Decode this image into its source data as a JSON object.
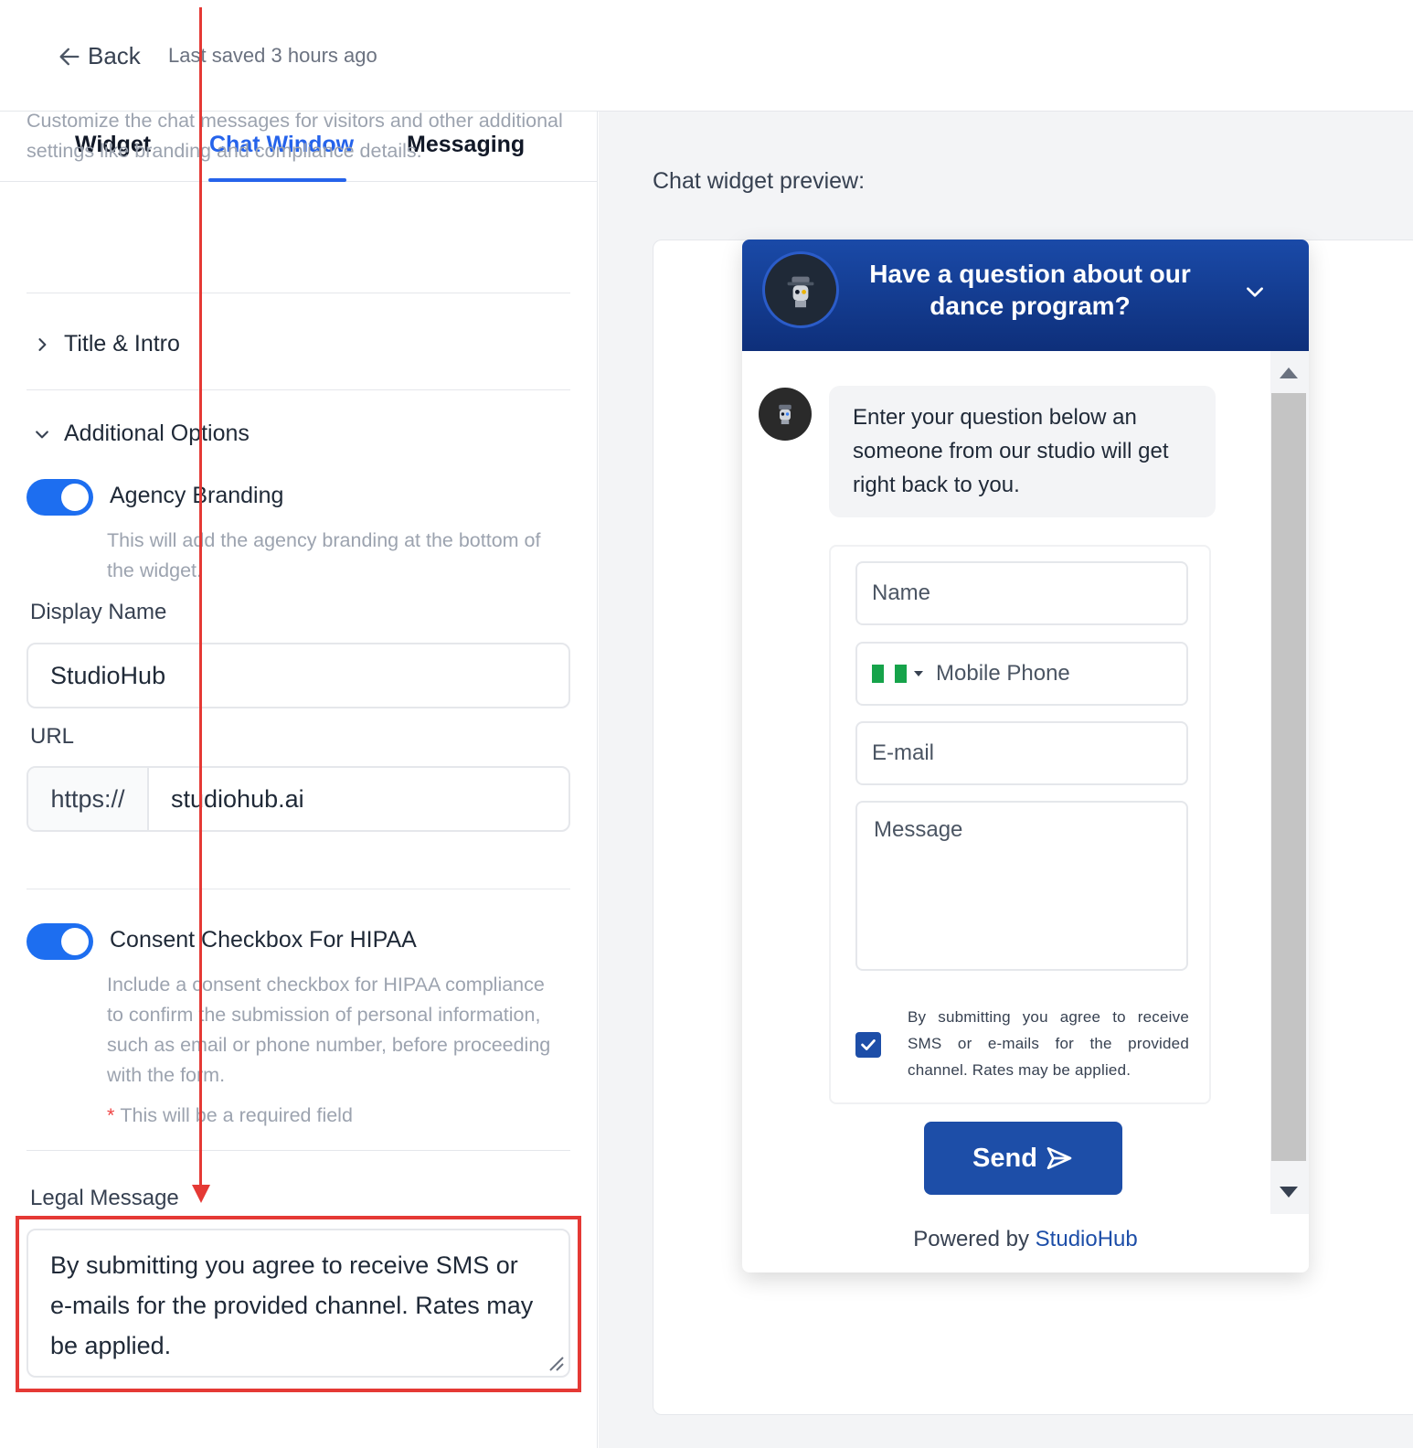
{
  "topbar": {
    "back_label": "Back",
    "saved_text": "Last saved 3 hours ago"
  },
  "tabs": [
    {
      "label": "Widget",
      "active": false
    },
    {
      "label": "Chat Window",
      "active": true
    },
    {
      "label": "Messaging",
      "active": false
    }
  ],
  "settings": {
    "description": "Customize the chat messages for visitors and other additional settings like branding and compliance details.",
    "sections": {
      "title_intro": "Title & Intro",
      "additional_options": "Additional Options"
    },
    "agency_branding": {
      "title": "Agency Branding",
      "enabled": true,
      "help": "This will add the agency branding at the bottom of the widget."
    },
    "display_name": {
      "label": "Display Name",
      "value": "StudioHub"
    },
    "url": {
      "label": "URL",
      "prefix": "https://",
      "value": "studiohub.ai"
    },
    "hipaa": {
      "title": "Consent Checkbox For HIPAA",
      "enabled": true,
      "help": "Include a consent checkbox for HIPAA compliance to confirm the submission of personal information, such as email or phone number, before proceeding with the form.",
      "required_note": "This will be a required field"
    },
    "legal_message": {
      "label": "Legal Message",
      "value": "By submitting you agree to receive SMS or e-mails for the provided channel. Rates may be applied."
    }
  },
  "preview": {
    "label": "Chat widget preview:",
    "header_title": "Have a question about our dance program?",
    "intro_message": "Enter your question below an someone from our studio will get right back to you.",
    "form": {
      "name_placeholder": "Name",
      "phone_placeholder": "Mobile Phone",
      "email_placeholder": "E-mail",
      "message_placeholder": "Message",
      "consent_checked": true,
      "consent_text": "By submitting you agree to receive SMS or e-mails for the provided channel. Rates may be applied."
    },
    "send_label": "Send",
    "powered_prefix": "Powered by",
    "powered_brand": "StudioHub"
  },
  "icons": {
    "back": "arrow-left-icon",
    "collapsed_chevron": "chevron-right-icon",
    "expanded_chevron": "chevron-down-icon",
    "send": "send-icon",
    "flag": "nigeria-flag-icon"
  },
  "colors": {
    "accent": "#2563eb",
    "toggle": "#1d6ef0",
    "widget_header": "#0e2f7a",
    "send_button": "#1d4ea8",
    "annotation": "#e53935"
  }
}
